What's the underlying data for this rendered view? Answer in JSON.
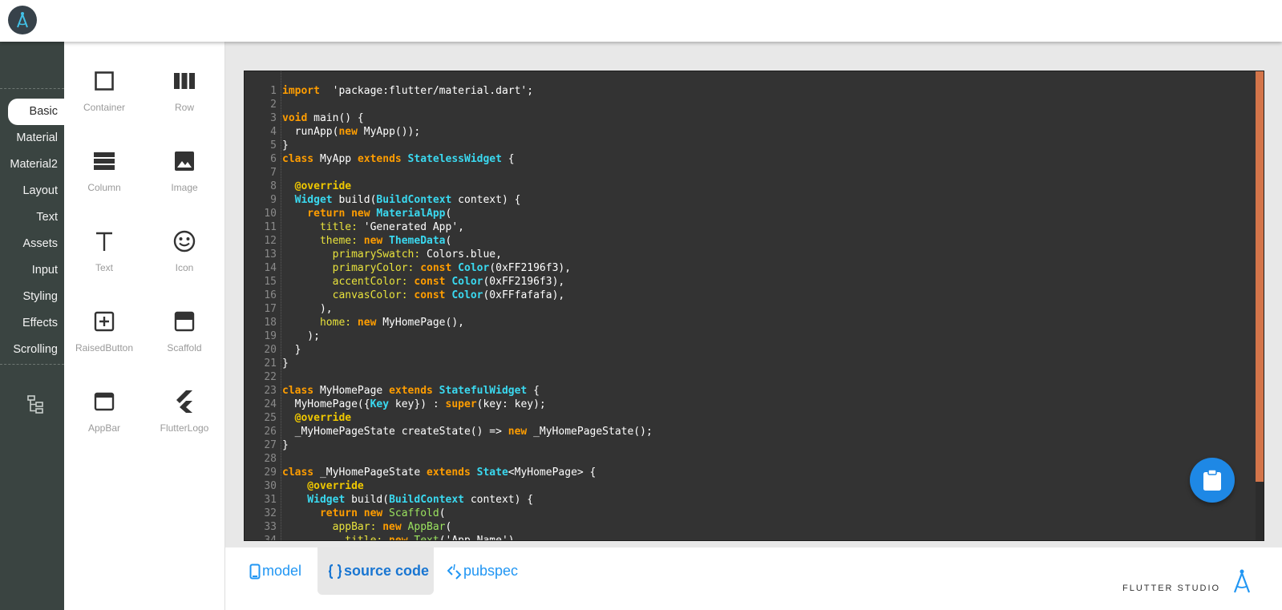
{
  "app": {
    "brand": "FLUTTER STUDIO",
    "accent_color": "#2196f3",
    "logo_icon": "compass-icon"
  },
  "nav": {
    "items": [
      {
        "label": "Basic",
        "active": true
      },
      {
        "label": "Material"
      },
      {
        "label": "Material2"
      },
      {
        "label": "Layout"
      },
      {
        "label": "Text"
      },
      {
        "label": "Assets"
      },
      {
        "label": "Input"
      },
      {
        "label": "Styling"
      },
      {
        "label": "Effects"
      },
      {
        "label": "Scrolling"
      }
    ],
    "tree_icon": "widget-tree-icon"
  },
  "palette": {
    "widgets": [
      {
        "label": "Container",
        "icon": "square-outline-icon"
      },
      {
        "label": "Row",
        "icon": "view-column-icon"
      },
      {
        "label": "Column",
        "icon": "view-stream-icon"
      },
      {
        "label": "Image",
        "icon": "image-icon"
      },
      {
        "label": "Text",
        "icon": "text-t-icon"
      },
      {
        "label": "Icon",
        "icon": "smiley-face-icon"
      },
      {
        "label": "RaisedButton",
        "icon": "plus-box-icon"
      },
      {
        "label": "Scaffold",
        "icon": "web-asset-icon"
      },
      {
        "label": "AppBar",
        "icon": "browser-window-icon"
      },
      {
        "label": "FlutterLogo",
        "icon": "flutter-logo-icon"
      }
    ]
  },
  "editor": {
    "lines": [
      [
        [
          "k",
          "import"
        ],
        [
          "",
          "  'package:flutter/material.dart';"
        ]
      ],
      [],
      [
        [
          "k",
          "void"
        ],
        [
          "",
          " main() {"
        ]
      ],
      [
        [
          "",
          "  runApp("
        ],
        [
          "k",
          "new"
        ],
        [
          "",
          " MyApp());"
        ]
      ],
      [
        [
          "",
          "}"
        ]
      ],
      [
        [
          "k",
          "class"
        ],
        [
          "",
          " MyApp "
        ],
        [
          "k",
          "extends"
        ],
        [
          "",
          ""
        ],
        [
          "t",
          " StatelessWidget"
        ],
        [
          "",
          " {"
        ]
      ],
      [],
      [
        [
          "a",
          "  @override"
        ]
      ],
      [
        [
          "t",
          "  Widget"
        ],
        [
          "",
          " build("
        ],
        [
          "t",
          "BuildContext"
        ],
        [
          "",
          " context) {"
        ]
      ],
      [
        [
          "k",
          "    return"
        ],
        [
          "",
          ""
        ],
        [
          "k",
          " new"
        ],
        [
          "t",
          " MaterialApp"
        ],
        [
          "",
          "("
        ]
      ],
      [
        [
          "p",
          "      title:"
        ],
        [
          "",
          ""
        ],
        [
          "",
          " 'Generated App',"
        ]
      ],
      [
        [
          "p",
          "      theme:"
        ],
        [
          "k",
          " new"
        ],
        [
          "t",
          " ThemeData"
        ],
        [
          "",
          "("
        ]
      ],
      [
        [
          "p",
          "        primarySwatch:"
        ],
        [
          "",
          " Colors.blue,"
        ]
      ],
      [
        [
          "p",
          "        primaryColor:"
        ],
        [
          "k",
          " const"
        ],
        [
          "t",
          " Color"
        ],
        [
          "",
          "(0xFF2196f3),"
        ]
      ],
      [
        [
          "p",
          "        accentColor:"
        ],
        [
          "k",
          " const"
        ],
        [
          "t",
          " Color"
        ],
        [
          "",
          "(0xFF2196f3),"
        ]
      ],
      [
        [
          "p",
          "        canvasColor:"
        ],
        [
          "k",
          " const"
        ],
        [
          "t",
          " Color"
        ],
        [
          "",
          "(0xFFfafafa),"
        ]
      ],
      [
        [
          "",
          "      ),"
        ]
      ],
      [
        [
          "p",
          "      home:"
        ],
        [
          "k",
          " new"
        ],
        [
          "",
          " MyHomePage(),"
        ]
      ],
      [
        [
          "",
          "    );"
        ]
      ],
      [
        [
          "",
          "  }"
        ]
      ],
      [
        [
          "",
          "}"
        ]
      ],
      [],
      [
        [
          "k",
          "class"
        ],
        [
          "",
          " MyHomePage "
        ],
        [
          "k",
          "extends"
        ],
        [
          "t",
          " StatefulWidget"
        ],
        [
          "",
          " {"
        ]
      ],
      [
        [
          "",
          "  MyHomePage({"
        ],
        [
          "t",
          "Key"
        ],
        [
          "",
          " key}) : "
        ],
        [
          "k",
          "super"
        ],
        [
          "",
          "(key: key);"
        ]
      ],
      [
        [
          "a",
          "  @override"
        ]
      ],
      [
        [
          "",
          "  _MyHomePageState createState() => "
        ],
        [
          "k",
          "new"
        ],
        [
          "",
          " _MyHomePageState();"
        ]
      ],
      [
        [
          "",
          "}"
        ]
      ],
      [],
      [
        [
          "k",
          "class"
        ],
        [
          "",
          " _MyHomePageState "
        ],
        [
          "k",
          "extends"
        ],
        [
          "t",
          " State"
        ],
        [
          "",
          "<MyHomePage> {"
        ]
      ],
      [
        [
          "a",
          "    @override"
        ]
      ],
      [
        [
          "t",
          "    Widget"
        ],
        [
          "",
          " build("
        ],
        [
          "t",
          "BuildContext"
        ],
        [
          "",
          " context) {"
        ]
      ],
      [
        [
          "k",
          "      return"
        ],
        [
          "k",
          " new"
        ],
        [
          "g",
          " Scaffold"
        ],
        [
          "",
          "("
        ]
      ],
      [
        [
          "p",
          "        appBar:"
        ],
        [
          "k",
          " new"
        ],
        [
          "g",
          " AppBar"
        ],
        [
          "",
          "("
        ]
      ],
      [
        [
          "p",
          "          title:"
        ],
        [
          "k",
          " new"
        ],
        [
          "g",
          " Text"
        ],
        [
          "",
          "('App Name')"
        ]
      ]
    ],
    "fab_icon": "clipboard-icon",
    "thumb_color": "#d4754a"
  },
  "tabs": [
    {
      "label": "model",
      "icon": "phone-icon"
    },
    {
      "label": "source code",
      "icon": "braces-icon",
      "active": true
    },
    {
      "label": "pubspec",
      "icon": "code-tag-icon"
    }
  ]
}
